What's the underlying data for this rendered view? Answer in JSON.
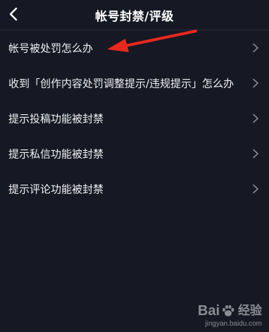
{
  "header": {
    "title": "帐号封禁/评级",
    "back_icon": "chevron-left-icon"
  },
  "list": {
    "items": [
      {
        "label": "帐号被处罚怎么办"
      },
      {
        "label": "收到「创作内容处罚调整提示/违规提示」怎么办"
      },
      {
        "label": "提示投稿功能被封禁"
      },
      {
        "label": "提示私信功能被封禁"
      },
      {
        "label": "提示评论功能被封禁"
      }
    ],
    "chevron_icon": "chevron-right-icon"
  },
  "annotation": {
    "arrow_color": "#e8281e"
  },
  "watermark": {
    "brand_prefix": "Bai",
    "brand_suffix": "经验",
    "url": "jingyan.baidu.com"
  },
  "colors": {
    "background": "#161823",
    "text": "#ffffff",
    "divider": "#2a2c36",
    "chevron": "#8a8b91"
  }
}
